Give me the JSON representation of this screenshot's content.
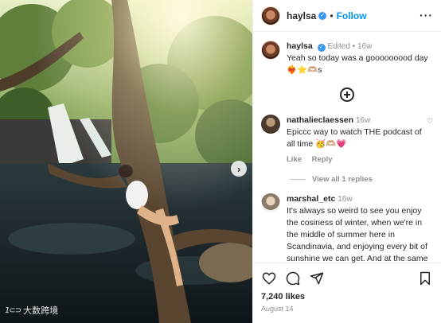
{
  "header": {
    "username": "haylsa",
    "verified_icon": "verified-badge-icon",
    "separator": "•",
    "follow_label": "Follow",
    "more_icon": "more-options-icon",
    "more_glyph": "···"
  },
  "caption": {
    "username": "haylsa",
    "meta": "Edited • 16w",
    "text": "Yeah so today was a gooooooood day ❤️‍🔥⭐🫶🏼s"
  },
  "comments": [
    {
      "username": "nathalieclaessen",
      "time": "16w",
      "text": "Epiccc way to watch THE podcast of all time 🥳🫶🏼💗",
      "like_label": "Like",
      "reply_label": "Reply",
      "view_replies": "View all 1 replies"
    },
    {
      "username": "marshal_etc",
      "time": "16w",
      "text": "It's always so weird to see you enjoy the cosiness of winter, when we're in the middle of summer here in Scandinavia, and enjoying every bit of sunshine we can get. And at the same time, I'm looking at your photos and thinking: ah,"
    }
  ],
  "footer": {
    "likes": "7,240 likes",
    "date": "August 14"
  },
  "photo": {
    "next_glyph": "›",
    "watermark": "大数跨境",
    "watermark_logo": "1⊂⊃"
  },
  "colors": {
    "accent": "#0095f6",
    "verified": "#3897f0",
    "muted": "#8e8e8e"
  }
}
